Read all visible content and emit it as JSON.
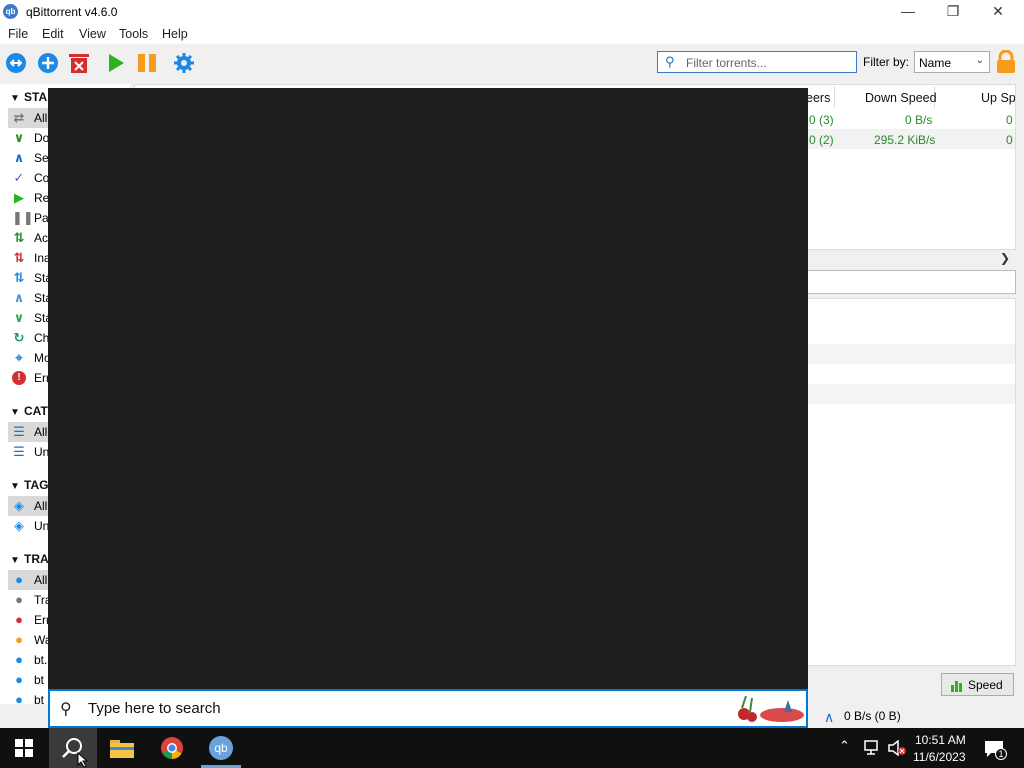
{
  "window": {
    "title": "qBittorrent v4.6.0"
  },
  "menu": [
    "File",
    "Edit",
    "View",
    "Tools",
    "Help"
  ],
  "toolbar": {
    "filter_placeholder": "Filter torrents...",
    "filter_by_label": "Filter by:",
    "filter_by_value": "Name"
  },
  "sidebar": {
    "status": {
      "title": "STA",
      "items": [
        "All",
        "Do",
        "Se",
        "Co",
        "Re",
        "Pa",
        "Ac",
        "Ina",
        "Sta",
        "Sta",
        "Sta",
        "Ch",
        "Mo",
        "Err"
      ]
    },
    "categories": {
      "title": "CAT",
      "items": [
        "All",
        "Un"
      ]
    },
    "tags": {
      "title": "TAG",
      "items": [
        "All",
        "Un"
      ]
    },
    "trackers": {
      "title": "TRA",
      "items": [
        "All",
        "Tra",
        "Err",
        "Wa",
        "bt.",
        "bt",
        "bt"
      ]
    }
  },
  "torrent_list": {
    "columns": [
      "eers",
      "Down Speed",
      "Up Sp"
    ],
    "rows": [
      {
        "peers": "0 (3)",
        "down_speed": "0 B/s",
        "up_speed": "0"
      },
      {
        "peers": "0 (2)",
        "down_speed": "295.2 KiB/s",
        "up_speed": "0"
      }
    ]
  },
  "speed_button": "Speed",
  "status_bar": {
    "upload": "0 B/s (0 B)"
  },
  "taskbar": {
    "search_placeholder": "Type here to search",
    "time": "10:51 AM",
    "date": "11/6/2023",
    "notification_count": "1"
  },
  "colors": {
    "accent": "#0078d7",
    "speed_green": "#2a8a2a",
    "taskbar": "#101010"
  }
}
